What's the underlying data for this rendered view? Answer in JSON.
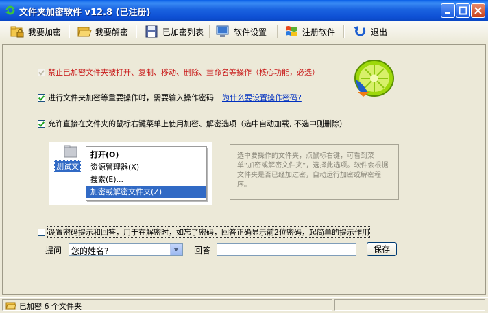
{
  "window": {
    "title": "文件夹加密软件 v12.8 (已注册)",
    "colors": {
      "titlebar": "#0a5fe8",
      "accent": "#316ac5",
      "warning_text": "#c81818",
      "link": "#0030c0"
    }
  },
  "toolbar": {
    "items": [
      {
        "label": "我要加密",
        "icon": "lock-folder-icon"
      },
      {
        "label": "我要解密",
        "icon": "open-folder-icon"
      },
      {
        "label": "已加密列表",
        "icon": "save-list-icon"
      },
      {
        "label": "软件设置",
        "icon": "monitor-settings-icon"
      },
      {
        "label": "注册软件",
        "icon": "windows-flag-icon"
      },
      {
        "label": "退出",
        "icon": "exit-arrow-icon"
      }
    ]
  },
  "options": {
    "core": {
      "label": "禁止已加密文件夹被打开、复制、移动、删除、重命名等操作（核心功能，必选）",
      "checked": true,
      "disabled": true
    },
    "password": {
      "label": "进行文件夹加密等重要操作时，需要输入操作密码",
      "checked": true,
      "link": "为什么要设置操作密码?"
    },
    "context_menu": {
      "label": "允许直接在文件夹的鼠标右键菜单上使用加密、解密选项（选中自动加载, 不选中则删除）",
      "checked": true
    },
    "hint": {
      "label": "设置密码提示和回答，用于在解密时，如忘了密码，回答正确显示前2位密码，起简单的提示作用",
      "checked": false
    }
  },
  "preview": {
    "folder_name": "测试文",
    "menu_items": [
      "打开(O)",
      "资源管理器(X)",
      "搜索(E)...",
      "加密或解密文件夹(Z)"
    ],
    "highlighted_index": 3,
    "info_text": "选中要操作的文件夹，点鼠标右键，可看到菜单“加密或解密文件夹”，选择此选项。软件会根据文件夹是否已经加过密，自动运行加密或解密程序。"
  },
  "hint_form": {
    "question_label": "提问",
    "question_value": "您的姓名?",
    "answer_label": "回答",
    "answer_value": "",
    "save_label": "保存"
  },
  "status": {
    "text": "已加密 6 个文件夹"
  }
}
